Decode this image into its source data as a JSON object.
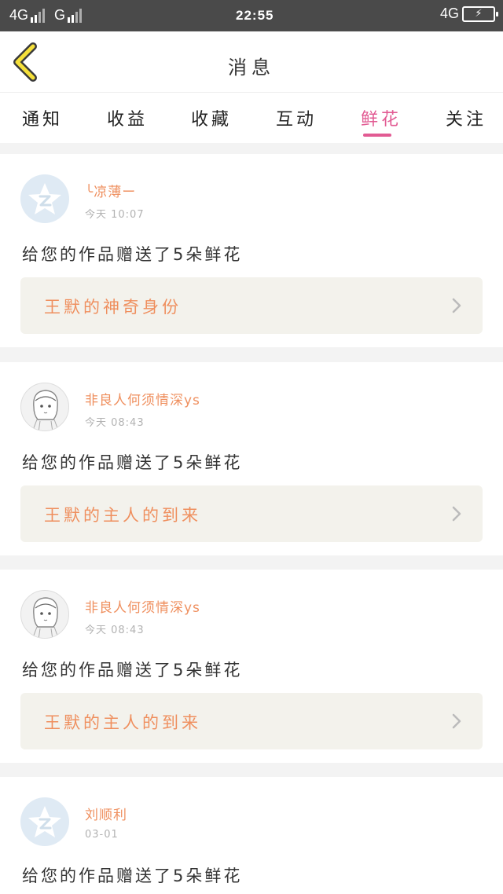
{
  "status_bar": {
    "network_1": "4G",
    "network_2": "G",
    "time": "22:55",
    "network_right": "4G",
    "battery_icon": "battery-charging-icon"
  },
  "header": {
    "title": "消息",
    "back_icon": "chevron-left-icon"
  },
  "tabs": [
    {
      "label": "通知",
      "active": false
    },
    {
      "label": "收益",
      "active": false
    },
    {
      "label": "收藏",
      "active": false
    },
    {
      "label": "互动",
      "active": false
    },
    {
      "label": "鲜花",
      "active": true
    },
    {
      "label": "关注",
      "active": false
    }
  ],
  "messages": [
    {
      "username": "╰凉薄ー",
      "time": "今天 10:07",
      "text": "给您的作品赠送了5朵鲜花",
      "work": "王默的神奇身份",
      "avatar": "qq-default-avatar"
    },
    {
      "username": "非良人何须情深ys",
      "time": "今天 08:43",
      "text": "给您的作品赠送了5朵鲜花",
      "work": "王默的主人的到来",
      "avatar": "anime-avatar"
    },
    {
      "username": "非良人何须情深ys",
      "time": "今天 08:43",
      "text": "给您的作品赠送了5朵鲜花",
      "work": "王默的主人的到来",
      "avatar": "anime-avatar"
    },
    {
      "username": "刘顺利",
      "time": "03-01",
      "text": "给您的作品赠送了5朵鲜花",
      "avatar": "qq-default-avatar"
    }
  ],
  "colors": {
    "accent_pink": "#e25b93",
    "username_orange": "#ef8f5e",
    "status_bar": "#4a4a4a",
    "link_bg": "#f3f2ec"
  }
}
